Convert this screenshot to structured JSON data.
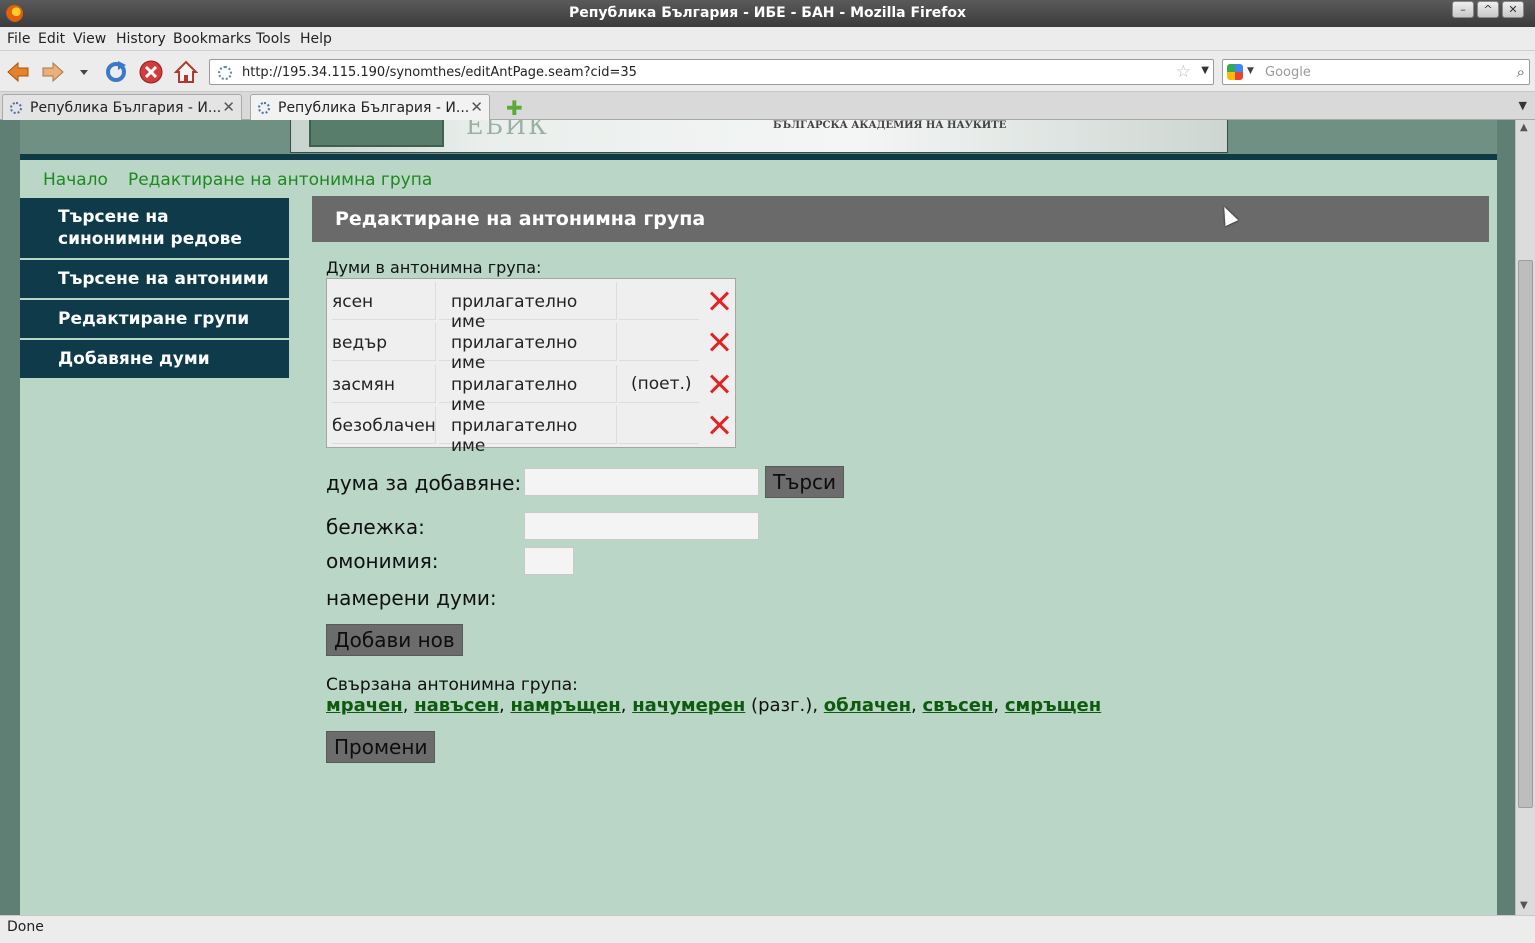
{
  "window": {
    "title": "Република България - ИБЕ - БАН - Mozilla Firefox"
  },
  "menu": [
    "File",
    "Edit",
    "View",
    "History",
    "Bookmarks",
    "Tools",
    "Help"
  ],
  "navbar": {
    "url": "http://195.34.115.190/synomthes/editAntPage.seam?cid=35",
    "search_placeholder": "Google"
  },
  "tabs": [
    {
      "label": "Република България - И...",
      "active": false
    },
    {
      "label": "Република България - И...",
      "active": true
    }
  ],
  "banner": {
    "acronym": "EБИК",
    "academy": "БЪЛГАРСКА АКАДЕМИЯ НА НАУКИТЕ"
  },
  "breadcrumbs": [
    "Начало",
    "Редактиране на антонимна група"
  ],
  "sidebar": [
    "Търсене на синонимни редове",
    "Търсене на антоними",
    "Редактиране групи",
    "Добавяне думи"
  ],
  "main": {
    "heading": "Редактиране на антонимна група",
    "words_label": "Думи в антонимна група:",
    "words": [
      {
        "word": "ясен",
        "pos": "прилагателно име",
        "note": ""
      },
      {
        "word": "ведър",
        "pos": "прилагателно име",
        "note": ""
      },
      {
        "word": "засмян",
        "pos": "прилагателно име",
        "note": "(поет.)"
      },
      {
        "word": "безоблачен",
        "pos": "прилагателно име",
        "note": ""
      }
    ],
    "add_word_label": "дума за добавяне:",
    "add_word_value": "",
    "search_button": "Търси",
    "note_label": "бележка:",
    "note_value": "",
    "homonymy_label": "омонимия:",
    "homonymy_value": "",
    "found_label": "намерени думи:",
    "add_new_button": "Добави нов",
    "linked_label": "Свързана антонимна група:",
    "linked_words": [
      {
        "word": "мрачен",
        "note": ""
      },
      {
        "word": "навъсен",
        "note": ""
      },
      {
        "word": "намръщен",
        "note": ""
      },
      {
        "word": "начумерен",
        "note": "(разг.)"
      },
      {
        "word": "облачен",
        "note": ""
      },
      {
        "word": "свъсен",
        "note": ""
      },
      {
        "word": "смръщен",
        "note": ""
      }
    ],
    "change_button": "Промени"
  },
  "status": {
    "text": "Done"
  },
  "colors": {
    "sidebar_bg": "#0e3a4a",
    "page_bg": "#b9d6c7",
    "heading_bg": "#6a6a6a",
    "delete": "#e02424",
    "link": "#0e5a0e"
  },
  "icons": [
    "firefox-logo-icon",
    "back-icon",
    "forward-icon",
    "reload-icon",
    "stop-icon",
    "home-icon",
    "bookmark-star-icon",
    "google-icon",
    "search-icon",
    "new-tab-icon",
    "delete-icon"
  ]
}
